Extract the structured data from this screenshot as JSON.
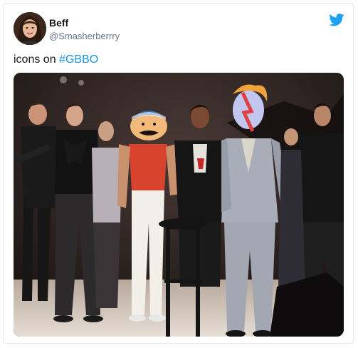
{
  "author": {
    "display_name": "Beff",
    "handle": "@Smasherberrry",
    "avatar_icon": "profile-photo"
  },
  "tweet": {
    "text_prefix": "icons on ",
    "hashtag": "#GBBO"
  },
  "brand": {
    "icon": "twitter-bird-icon",
    "color": "#1da1f2"
  },
  "media": {
    "description_icon": "concert-stage-photo"
  }
}
